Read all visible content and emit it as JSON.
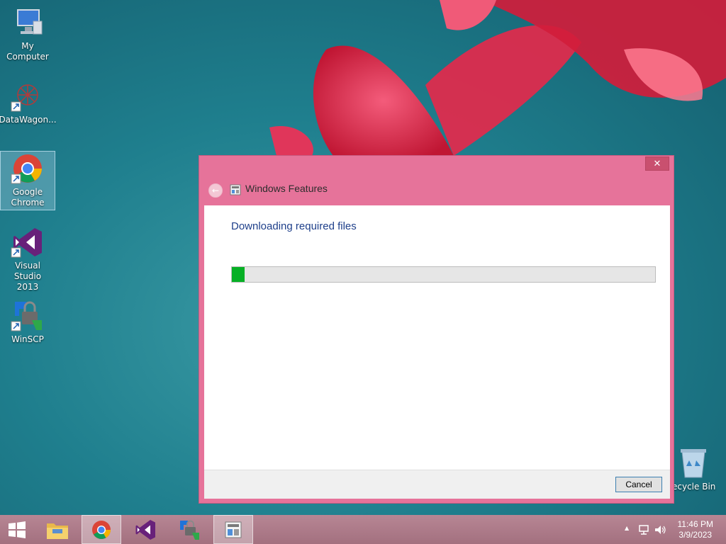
{
  "desktop": {
    "icons": [
      {
        "label": "My Computer",
        "icon": "computer-icon"
      },
      {
        "label": "DataWagon...",
        "icon": "datawagon-icon"
      },
      {
        "label": "Google Chrome",
        "line1": "Google",
        "line2": "Chrome",
        "icon": "chrome-icon"
      },
      {
        "label": "Visual Studio 2013",
        "line1": "Visual Studio",
        "line2": "2013",
        "icon": "visual-studio-icon"
      },
      {
        "label": "WinSCP",
        "icon": "winscp-icon"
      },
      {
        "label": "ecycle Bin",
        "icon": "recycle-bin-icon"
      }
    ]
  },
  "dialog": {
    "title": "Windows Features",
    "close_glyph": "✕",
    "back_glyph": "←",
    "heading": "Downloading required files",
    "progress_fraction": 0.03,
    "cancel_label": "Cancel",
    "accent": "#e6739a",
    "progress_color": "#06b025"
  },
  "taskbar": {
    "items": [
      {
        "icon": "windows-start-icon"
      },
      {
        "icon": "file-explorer-icon"
      },
      {
        "icon": "chrome-icon"
      },
      {
        "icon": "visual-studio-icon"
      },
      {
        "icon": "winscp-icon"
      },
      {
        "icon": "windows-features-icon"
      }
    ],
    "tray": {
      "expand_glyph": "▲",
      "time": "11:46 PM",
      "date": "3/9/2023"
    }
  }
}
